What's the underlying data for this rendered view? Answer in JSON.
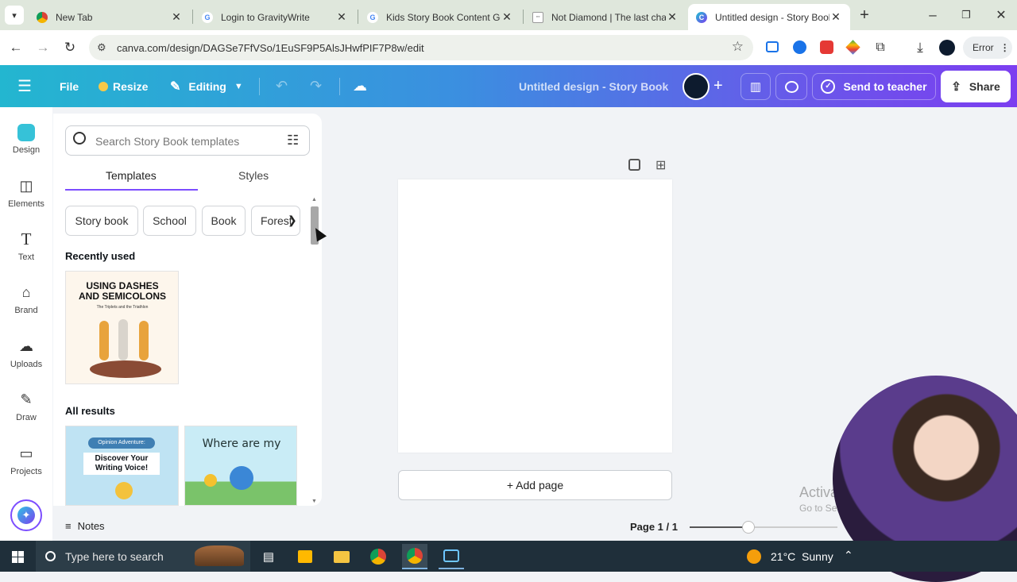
{
  "browser": {
    "tabs": [
      {
        "title": "New Tab",
        "icon": "chrome-icon"
      },
      {
        "title": "Login to GravityWrite",
        "icon": "google-icon"
      },
      {
        "title": "Kids Story Book Content Ge",
        "icon": "google-icon"
      },
      {
        "title": "Not Diamond | The last chat",
        "icon": "notdiamond-icon"
      },
      {
        "title": "Untitled design - Story Book",
        "icon": "canva-icon"
      }
    ],
    "url": "canva.com/design/DAGSe7FfVSo/1EuSF9P5AlsJHwfPIF7P8w/edit",
    "error_label": "Error"
  },
  "header": {
    "file": "File",
    "resize": "Resize",
    "editing": "Editing",
    "doc_title": "Untitled design - Story Book",
    "send": "Send to teacher",
    "share": "Share"
  },
  "rail": [
    {
      "label": "Design",
      "icon": "design-icon"
    },
    {
      "label": "Elements",
      "icon": "elements-icon"
    },
    {
      "label": "Text",
      "icon": "text-icon"
    },
    {
      "label": "Brand",
      "icon": "brand-icon"
    },
    {
      "label": "Uploads",
      "icon": "uploads-icon"
    },
    {
      "label": "Draw",
      "icon": "draw-icon"
    },
    {
      "label": "Projects",
      "icon": "projects-icon"
    }
  ],
  "panel": {
    "search_placeholder": "Search Story Book templates",
    "tabs": [
      "Templates",
      "Styles"
    ],
    "chips": [
      "Story book",
      "School",
      "Book",
      "Forest"
    ],
    "recently_used": "Recently used",
    "recent_thumb": {
      "title": "USING DASHES AND SEMICOLONS",
      "subtitle": "The Triplets and the Triathlon"
    },
    "all_results": "All results",
    "result_thumbs": [
      {
        "tag": "Opinion Adventure:",
        "title": "Discover Your Writing Voice!"
      },
      {
        "title": "Where are my"
      }
    ]
  },
  "canvas": {
    "add_page": "+ Add page",
    "page_indicator": "Page 1 / 1"
  },
  "footer": {
    "notes": "Notes"
  },
  "watermark": {
    "line1": "Activa",
    "line2": "Go to Se"
  },
  "taskbar": {
    "search_placeholder": "Type here to search",
    "weather": "21°C  Sunny"
  }
}
